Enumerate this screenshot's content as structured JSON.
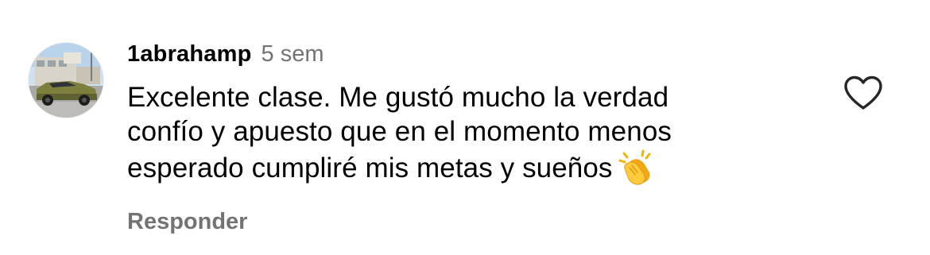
{
  "comment": {
    "username": "1abrahamp",
    "timestamp": "5 sem",
    "text_lines": [
      "Excelente clase. Me gustó mucho la verdad",
      "confío y apuesto que en el momento menos",
      "esperado cumpliré mis metas y sueños"
    ],
    "emoji": "clapping-hands-emoji",
    "reply_label": "Responder",
    "like_icon": "heart-outline-icon"
  },
  "colors": {
    "text": "#000000",
    "secondary": "#737373",
    "background": "#ffffff",
    "heart_stroke": "#262626"
  }
}
